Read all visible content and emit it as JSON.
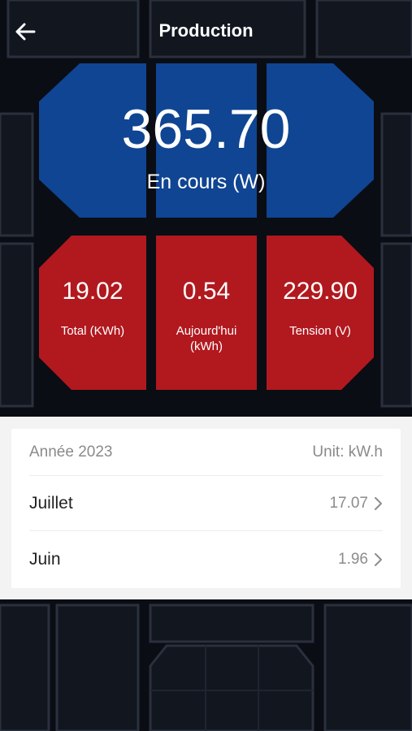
{
  "header": {
    "title": "Production",
    "back_icon": "arrow-left-icon"
  },
  "current": {
    "value": "365.70",
    "label": "En cours (W)"
  },
  "stats": [
    {
      "value": "19.02",
      "label": "Total (KWh)"
    },
    {
      "value": "0.54",
      "label": "Aujourd'hui (kWh)"
    },
    {
      "value": "229.90",
      "label": "Tension (V)"
    }
  ],
  "history": {
    "year_label": "Année 2023",
    "unit_label": "Unit: kW.h",
    "rows": [
      {
        "month": "Juillet",
        "value": "17.07"
      },
      {
        "month": "Juin",
        "value": "1.96"
      }
    ]
  },
  "colors": {
    "blue_panel": "#0f4592",
    "red_panel": "#b1191f",
    "background": "#0a0d14",
    "chevron_icon": "chevron-right-icon"
  }
}
